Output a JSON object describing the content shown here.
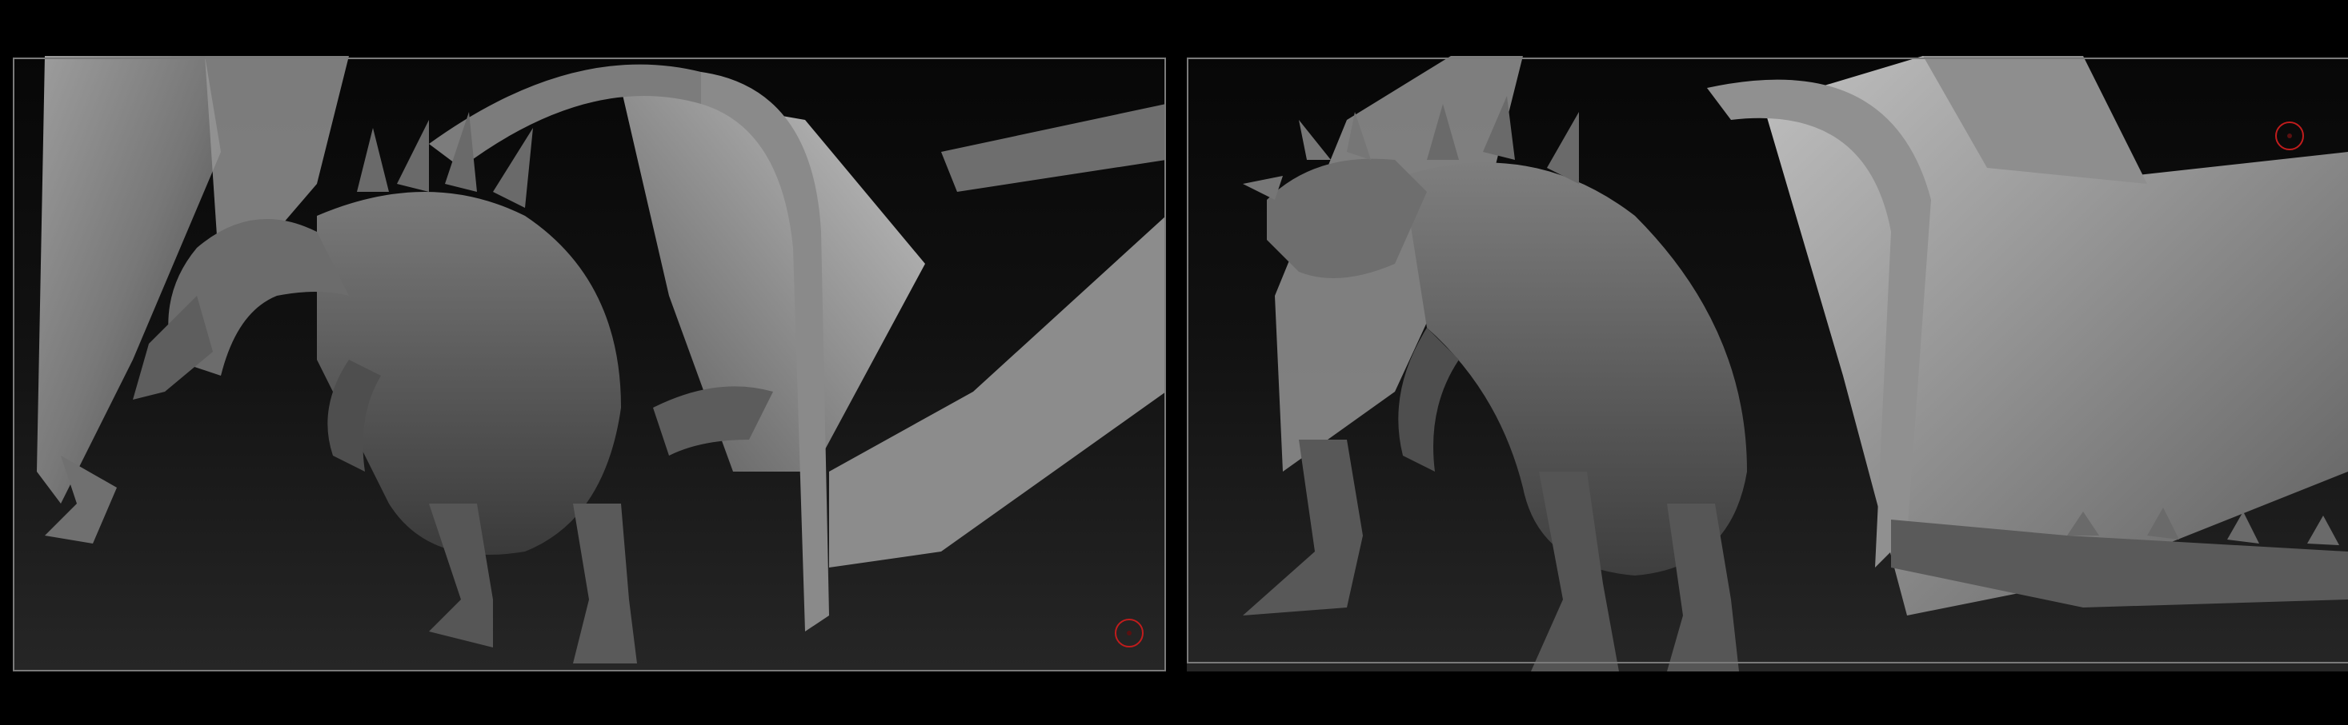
{
  "image": {
    "kind": "side-by-side 3D sculpt renders",
    "subject": "dragon",
    "background": "#000000",
    "panel_gradient_top": "#070707",
    "panel_gradient_bottom": "#262626",
    "frame_color": "#7a7a7a",
    "icon_color": "#c11c1c"
  },
  "views": [
    {
      "id": "left",
      "icon": "floor-grid-icon"
    },
    {
      "id": "right",
      "icon": "floor-grid-icon"
    }
  ]
}
